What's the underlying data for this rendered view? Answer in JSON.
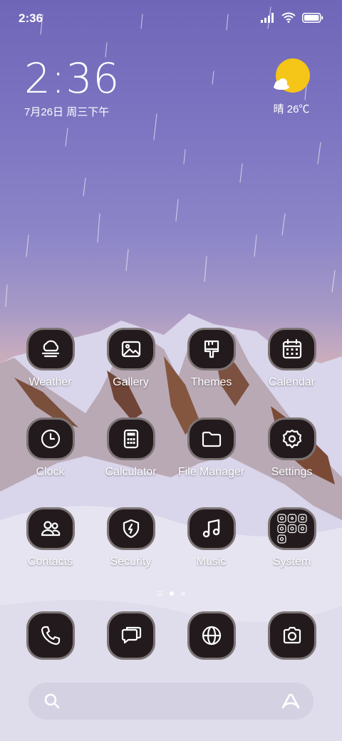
{
  "status_bar": {
    "time": "2:36",
    "icons": [
      "signal-icon",
      "wifi-icon",
      "battery-icon"
    ]
  },
  "clock_widget": {
    "time": "2:36",
    "date": "7月26日 周三下午"
  },
  "weather_widget": {
    "icon": "sun-cloud-icon",
    "text": "晴 26℃"
  },
  "apps": [
    [
      {
        "label": "Weather",
        "icon": "cloud-icon"
      },
      {
        "label": "Gallery",
        "icon": "image-icon"
      },
      {
        "label": "Themes",
        "icon": "brush-icon"
      },
      {
        "label": "Calendar",
        "icon": "calendar-icon"
      }
    ],
    [
      {
        "label": "Clock",
        "icon": "clock-icon"
      },
      {
        "label": "Calculator",
        "icon": "calculator-icon"
      },
      {
        "label": "File Manager",
        "icon": "folder-icon"
      },
      {
        "label": "Settings",
        "icon": "gear-icon"
      }
    ],
    [
      {
        "label": "Contacts",
        "icon": "contacts-icon"
      },
      {
        "label": "Security",
        "icon": "shield-icon"
      },
      {
        "label": "Music",
        "icon": "music-note-icon"
      },
      {
        "label": "System",
        "icon": "folder-grid-icon"
      }
    ]
  ],
  "page_indicator": {
    "pages": 2,
    "active": 1
  },
  "dock": [
    {
      "icon": "phone-icon"
    },
    {
      "icon": "messages-icon"
    },
    {
      "icon": "browser-globe-icon"
    },
    {
      "icon": "camera-icon"
    }
  ],
  "search_bar": {
    "left_icon": "search-icon",
    "right_icon": "assistant-icon"
  },
  "colors": {
    "icon_background": "#221a1c",
    "icon_border": "#7d7475",
    "sun": "#f5c518"
  }
}
